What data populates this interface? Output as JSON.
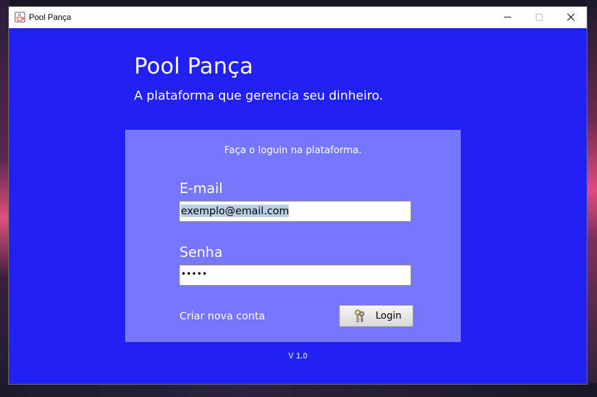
{
  "window": {
    "title": "Pool Pança",
    "app_icon": "java-cup-icon",
    "controls": [
      "minimize-icon",
      "maximize-icon",
      "close-icon"
    ]
  },
  "header": {
    "title": "Pool Pança",
    "subtitle": "A plataforma que gerencia seu dinheiro."
  },
  "login_panel": {
    "hint": "Faça o loguin na plataforma.",
    "email_label": "E-mail",
    "email_value": "exemplo@email.com",
    "password_label": "Senha",
    "password_value": "•••••",
    "create_account_link": "Criar nova conta",
    "login_button": "Login",
    "login_icon": "keys-icon"
  },
  "footer": {
    "version": "V 1.0"
  },
  "colors": {
    "background": "#2121f5",
    "panel": "#7676ff",
    "text": "#ffffff"
  }
}
